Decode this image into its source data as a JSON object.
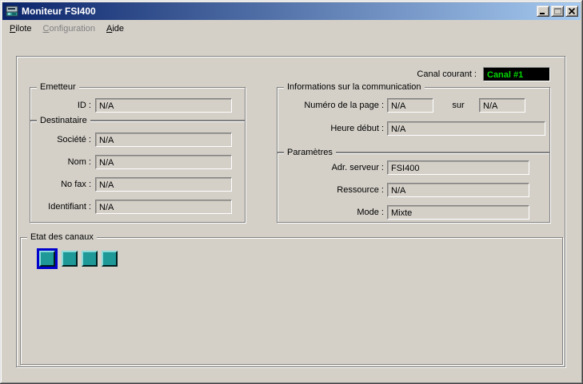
{
  "window": {
    "title": "Moniteur FSI400",
    "controls": {
      "minimize": "minimize",
      "maximize": "maximize (disabled)",
      "close": "close"
    }
  },
  "menu": {
    "items": [
      {
        "key": "P",
        "rest": "ilote",
        "enabled": true
      },
      {
        "key": "C",
        "rest": "onfiguration",
        "enabled": false
      },
      {
        "key": "A",
        "rest": "ide",
        "enabled": true
      }
    ]
  },
  "canal": {
    "label": "Canal courant :",
    "value": "Canal #1"
  },
  "groups": {
    "emetteur": {
      "title": "Emetteur",
      "rows": [
        {
          "label": "ID :",
          "value": "N/A"
        }
      ]
    },
    "destinataire": {
      "title": "Destinataire",
      "rows": [
        {
          "label": "Société :",
          "value": "N/A"
        },
        {
          "label": "Nom :",
          "value": "N/A"
        },
        {
          "label": "No fax :",
          "value": "N/A"
        },
        {
          "label": "Identifiant :",
          "value": "N/A"
        }
      ]
    },
    "infos": {
      "title": "Informations sur la communication",
      "page_label": "Numéro de la page :",
      "page_value": "N/A",
      "page_sep": "sur",
      "page_total": "N/A",
      "heure_label": "Heure début :",
      "heure_value": "N/A"
    },
    "parametres": {
      "title": "Paramètres",
      "rows": [
        {
          "label": "Adr. serveur :",
          "value": "FSI400"
        },
        {
          "label": "Ressource :",
          "value": "N/A"
        },
        {
          "label": "Mode :",
          "value": "Mixte"
        }
      ]
    },
    "etat": {
      "title": "Etat des canaux",
      "channels": [
        {
          "selected": true
        },
        {
          "selected": false
        },
        {
          "selected": false
        },
        {
          "selected": false
        }
      ]
    }
  },
  "colors": {
    "dialog_face": "#d4d0c8",
    "titlebar_left": "#0a246a",
    "titlebar_right": "#a6caf0",
    "canal_field_bg": "#000000",
    "canal_field_text": "#00d800",
    "channel_fill": "#1f9898",
    "channel_highlight": "#8adada",
    "channel_shadow": "#001f1f",
    "selection_blue": "#0000cc"
  }
}
